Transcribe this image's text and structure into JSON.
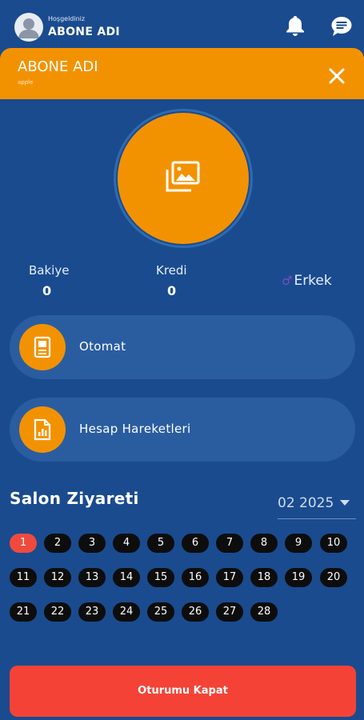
{
  "header": {
    "greeting": "Hoşgeldiniz",
    "username": "ABONE ADI",
    "avatar_icon": "user-avatar-icon",
    "notification_icon": "bell-icon",
    "chat_icon": "chat-icon"
  },
  "banner": {
    "title": "ABONE ADI",
    "subtitle": "apple",
    "close_icon": "close-icon",
    "color": "#f39200"
  },
  "profile": {
    "photo_icon": "photo-gallery-icon"
  },
  "stats": {
    "balance_label": "Bakiye",
    "balance_value": "0",
    "credit_label": "Kredi",
    "credit_value": "0",
    "gender": "Erkek",
    "gender_icon": "male-icon"
  },
  "menu": [
    {
      "label": "Otomat",
      "icon": "vending-machine-icon"
    },
    {
      "label": "Hesap Hareketleri",
      "icon": "account-report-icon"
    }
  ],
  "salon": {
    "title": "Salon Ziyareti",
    "month": "02 2025",
    "days": [
      "1",
      "2",
      "3",
      "4",
      "5",
      "6",
      "7",
      "8",
      "9",
      "10",
      "11",
      "12",
      "13",
      "14",
      "15",
      "16",
      "17",
      "18",
      "19",
      "20",
      "21",
      "22",
      "23",
      "24",
      "25",
      "26",
      "27",
      "28"
    ],
    "highlighted_day": "1"
  },
  "logout_label": "Oturumu Kapat",
  "colors": {
    "background": "#1a4b8f",
    "accent": "#f39200",
    "danger": "#f44336"
  }
}
